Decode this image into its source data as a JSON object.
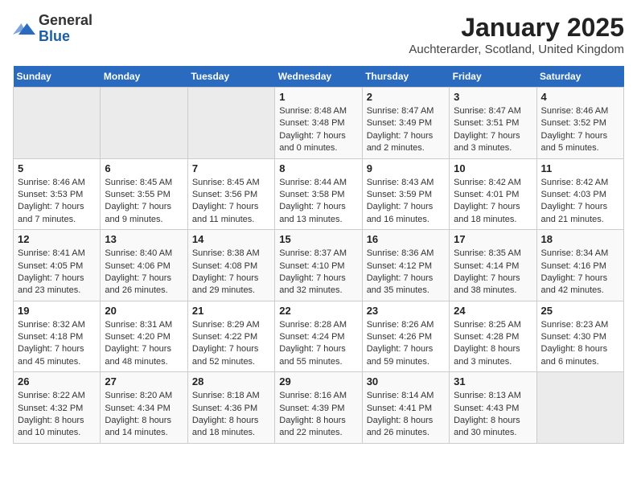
{
  "header": {
    "logo_general": "General",
    "logo_blue": "Blue",
    "month_title": "January 2025",
    "location": "Auchterarder, Scotland, United Kingdom"
  },
  "weekdays": [
    "Sunday",
    "Monday",
    "Tuesday",
    "Wednesday",
    "Thursday",
    "Friday",
    "Saturday"
  ],
  "weeks": [
    [
      {
        "day": "",
        "info": ""
      },
      {
        "day": "",
        "info": ""
      },
      {
        "day": "",
        "info": ""
      },
      {
        "day": "1",
        "info": "Sunrise: 8:48 AM\nSunset: 3:48 PM\nDaylight: 7 hours\nand 0 minutes."
      },
      {
        "day": "2",
        "info": "Sunrise: 8:47 AM\nSunset: 3:49 PM\nDaylight: 7 hours\nand 2 minutes."
      },
      {
        "day": "3",
        "info": "Sunrise: 8:47 AM\nSunset: 3:51 PM\nDaylight: 7 hours\nand 3 minutes."
      },
      {
        "day": "4",
        "info": "Sunrise: 8:46 AM\nSunset: 3:52 PM\nDaylight: 7 hours\nand 5 minutes."
      }
    ],
    [
      {
        "day": "5",
        "info": "Sunrise: 8:46 AM\nSunset: 3:53 PM\nDaylight: 7 hours\nand 7 minutes."
      },
      {
        "day": "6",
        "info": "Sunrise: 8:45 AM\nSunset: 3:55 PM\nDaylight: 7 hours\nand 9 minutes."
      },
      {
        "day": "7",
        "info": "Sunrise: 8:45 AM\nSunset: 3:56 PM\nDaylight: 7 hours\nand 11 minutes."
      },
      {
        "day": "8",
        "info": "Sunrise: 8:44 AM\nSunset: 3:58 PM\nDaylight: 7 hours\nand 13 minutes."
      },
      {
        "day": "9",
        "info": "Sunrise: 8:43 AM\nSunset: 3:59 PM\nDaylight: 7 hours\nand 16 minutes."
      },
      {
        "day": "10",
        "info": "Sunrise: 8:42 AM\nSunset: 4:01 PM\nDaylight: 7 hours\nand 18 minutes."
      },
      {
        "day": "11",
        "info": "Sunrise: 8:42 AM\nSunset: 4:03 PM\nDaylight: 7 hours\nand 21 minutes."
      }
    ],
    [
      {
        "day": "12",
        "info": "Sunrise: 8:41 AM\nSunset: 4:05 PM\nDaylight: 7 hours\nand 23 minutes."
      },
      {
        "day": "13",
        "info": "Sunrise: 8:40 AM\nSunset: 4:06 PM\nDaylight: 7 hours\nand 26 minutes."
      },
      {
        "day": "14",
        "info": "Sunrise: 8:38 AM\nSunset: 4:08 PM\nDaylight: 7 hours\nand 29 minutes."
      },
      {
        "day": "15",
        "info": "Sunrise: 8:37 AM\nSunset: 4:10 PM\nDaylight: 7 hours\nand 32 minutes."
      },
      {
        "day": "16",
        "info": "Sunrise: 8:36 AM\nSunset: 4:12 PM\nDaylight: 7 hours\nand 35 minutes."
      },
      {
        "day": "17",
        "info": "Sunrise: 8:35 AM\nSunset: 4:14 PM\nDaylight: 7 hours\nand 38 minutes."
      },
      {
        "day": "18",
        "info": "Sunrise: 8:34 AM\nSunset: 4:16 PM\nDaylight: 7 hours\nand 42 minutes."
      }
    ],
    [
      {
        "day": "19",
        "info": "Sunrise: 8:32 AM\nSunset: 4:18 PM\nDaylight: 7 hours\nand 45 minutes."
      },
      {
        "day": "20",
        "info": "Sunrise: 8:31 AM\nSunset: 4:20 PM\nDaylight: 7 hours\nand 48 minutes."
      },
      {
        "day": "21",
        "info": "Sunrise: 8:29 AM\nSunset: 4:22 PM\nDaylight: 7 hours\nand 52 minutes."
      },
      {
        "day": "22",
        "info": "Sunrise: 8:28 AM\nSunset: 4:24 PM\nDaylight: 7 hours\nand 55 minutes."
      },
      {
        "day": "23",
        "info": "Sunrise: 8:26 AM\nSunset: 4:26 PM\nDaylight: 7 hours\nand 59 minutes."
      },
      {
        "day": "24",
        "info": "Sunrise: 8:25 AM\nSunset: 4:28 PM\nDaylight: 8 hours\nand 3 minutes."
      },
      {
        "day": "25",
        "info": "Sunrise: 8:23 AM\nSunset: 4:30 PM\nDaylight: 8 hours\nand 6 minutes."
      }
    ],
    [
      {
        "day": "26",
        "info": "Sunrise: 8:22 AM\nSunset: 4:32 PM\nDaylight: 8 hours\nand 10 minutes."
      },
      {
        "day": "27",
        "info": "Sunrise: 8:20 AM\nSunset: 4:34 PM\nDaylight: 8 hours\nand 14 minutes."
      },
      {
        "day": "28",
        "info": "Sunrise: 8:18 AM\nSunset: 4:36 PM\nDaylight: 8 hours\nand 18 minutes."
      },
      {
        "day": "29",
        "info": "Sunrise: 8:16 AM\nSunset: 4:39 PM\nDaylight: 8 hours\nand 22 minutes."
      },
      {
        "day": "30",
        "info": "Sunrise: 8:14 AM\nSunset: 4:41 PM\nDaylight: 8 hours\nand 26 minutes."
      },
      {
        "day": "31",
        "info": "Sunrise: 8:13 AM\nSunset: 4:43 PM\nDaylight: 8 hours\nand 30 minutes."
      },
      {
        "day": "",
        "info": ""
      }
    ]
  ]
}
